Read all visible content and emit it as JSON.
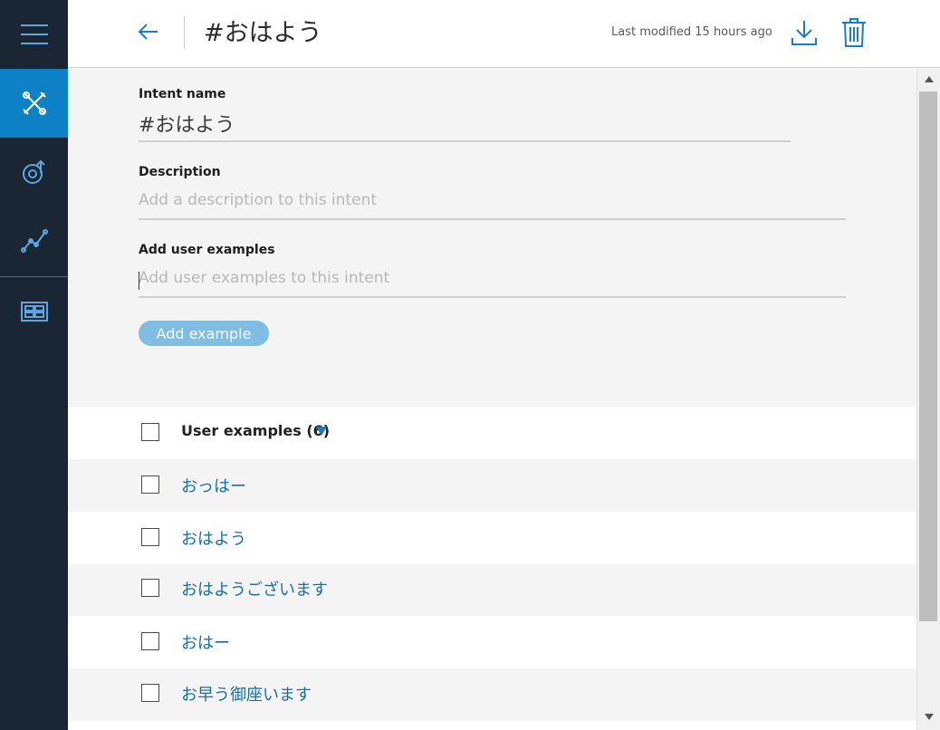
{
  "header": {
    "title": "#おはよう",
    "last_modified": "Last modified 15 hours ago"
  },
  "sidebar": {
    "items": [
      {
        "icon": "menu-icon"
      },
      {
        "icon": "tools-icon",
        "active": true
      },
      {
        "icon": "dialog-icon"
      },
      {
        "icon": "analytics-icon"
      },
      {
        "icon": "grid-icon"
      }
    ]
  },
  "form": {
    "intent_name_label": "Intent name",
    "intent_name_value": "#おはよう",
    "description_label": "Description",
    "description_placeholder": "Add a description to this intent",
    "examples_label": "Add user examples",
    "examples_placeholder": "Add user examples to this intent",
    "add_button_label": "Add example"
  },
  "examples": {
    "header_label": "User examples (6)",
    "items": [
      "おっはー",
      "おはよう",
      "おはようございます",
      "おはー",
      "お早う御座います"
    ]
  },
  "colors": {
    "sidebar_bg": "#1b2634",
    "accent": "#0d80c6",
    "link": "#1a6fa8"
  }
}
